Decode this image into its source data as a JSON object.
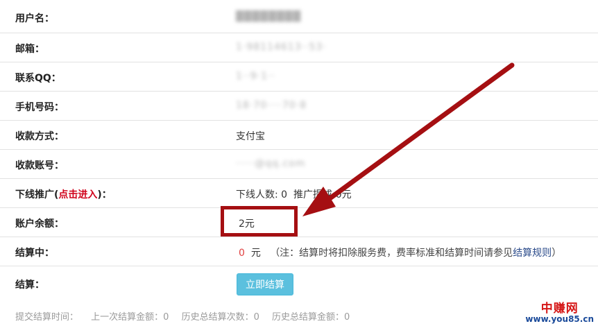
{
  "rows": [
    {
      "label": "用户名：",
      "value_blurred": "████████"
    },
    {
      "label": "邮箱：",
      "value_blurred": "1·98114613··53·"
    },
    {
      "label": "联系QQ：",
      "value_blurred": "1··9·1··"
    },
    {
      "label": "手机号码：",
      "value_blurred": "18·70····70·8"
    },
    {
      "label": "收款方式：",
      "value": "支付宝"
    },
    {
      "label": "收款账号：",
      "value_blurred": "·····@qq.com"
    },
    {
      "label_before": "下线推广(",
      "label_link": "点击进入",
      "label_after": ")：",
      "downline_label": "下线人数:",
      "downline_count": "0",
      "promo_label": "推广提成:",
      "promo_value": "0元"
    },
    {
      "label": "账户余额：",
      "value": "2元"
    },
    {
      "label": "结算中：",
      "amount": "0",
      "unit": "元",
      "note_before": "（注：结算时将扣除服务费，费率标准和结算时间请参见",
      "note_link": "结算规则",
      "note_after": "）"
    },
    {
      "label": "结算：",
      "button": "立即结算"
    }
  ],
  "footer": {
    "submit_time": "提交结算时间：",
    "last_amount": "上一次结算金额：0",
    "total_count": "历史总结算次数：0",
    "total_amount": "历史总结算金额：0"
  },
  "watermark": {
    "top": "中赚网",
    "bottom": "www.you85.cn"
  },
  "colors": {
    "annotation": "#a50f12",
    "button": "#5bc0de",
    "link": "#d0021b"
  }
}
